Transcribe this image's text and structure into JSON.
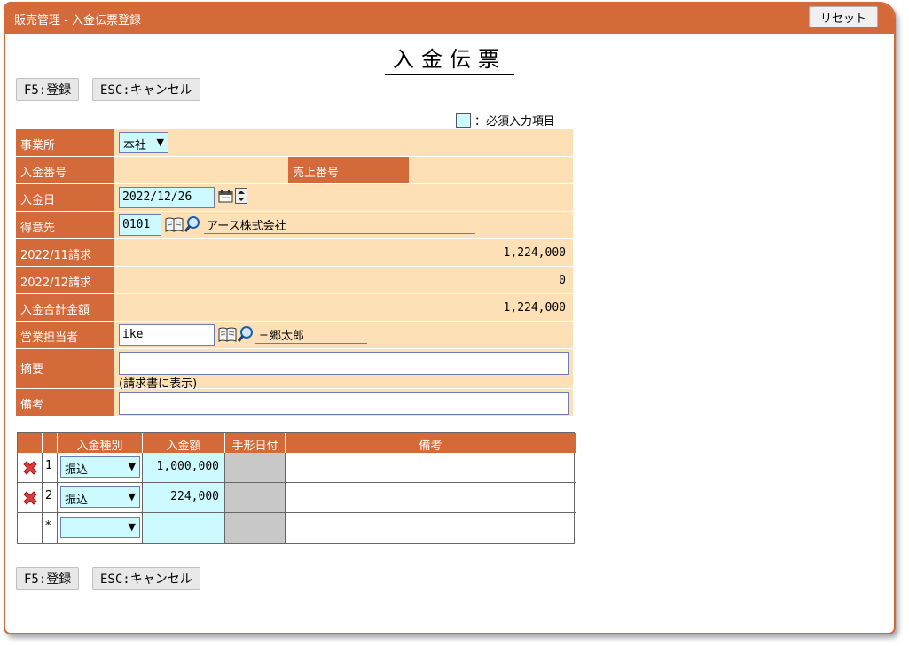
{
  "window": {
    "title": "販売管理 - 入金伝票登録",
    "reset_label": "リセット"
  },
  "page_title": "入金伝票",
  "actions": {
    "register_label": "F5:登録",
    "cancel_label": "ESC:キャンセル"
  },
  "legend": {
    "text": "：必須入力項目"
  },
  "form": {
    "office": {
      "label": "事業所",
      "value": "本社"
    },
    "payment_no": {
      "label": "入金番号",
      "value": ""
    },
    "sales_no": {
      "label": "売上番号",
      "value": ""
    },
    "payment_date": {
      "label": "入金日",
      "value": "2022/12/26"
    },
    "customer": {
      "label": "得意先",
      "code": "0101",
      "name": "アース株式会社"
    },
    "billing_nov": {
      "label": "2022/11請求",
      "value": "1,224,000"
    },
    "billing_dec": {
      "label": "2022/12請求",
      "value": "0"
    },
    "total": {
      "label": "入金合計金額",
      "value": "1,224,000"
    },
    "sales_rep": {
      "label": "営業担当者",
      "code": "ike",
      "name": "三郷太郎"
    },
    "summary": {
      "label": "摘要",
      "value": "",
      "note": "(請求書に表示)"
    },
    "remarks": {
      "label": "備考",
      "value": ""
    }
  },
  "detail": {
    "headers": [
      "入金種別",
      "入金額",
      "手形日付",
      "備考"
    ],
    "rows": [
      {
        "no": "1",
        "type": "振込",
        "amount": "1,000,000",
        "bill_date": "",
        "note": ""
      },
      {
        "no": "2",
        "type": "振込",
        "amount": "224,000",
        "bill_date": "",
        "note": ""
      },
      {
        "no": "*",
        "type": "",
        "amount": "",
        "bill_date": "",
        "note": ""
      }
    ]
  },
  "colors": {
    "accent": "#d4693a",
    "form_bg": "#fde0b6",
    "required_bg": "#ccfaff"
  }
}
